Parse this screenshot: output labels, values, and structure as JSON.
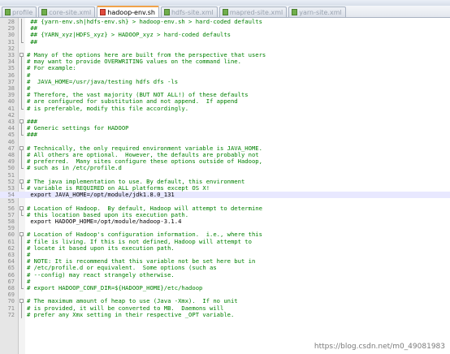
{
  "tabs": [
    {
      "label": "profile",
      "icon": "green",
      "active": false
    },
    {
      "label": "core-site.xml",
      "icon": "green",
      "active": false
    },
    {
      "label": "hadoop-env.sh",
      "icon": "red",
      "active": true
    },
    {
      "label": "hdfs-site.xml",
      "icon": "green",
      "active": false
    },
    {
      "label": "mapred-site.xml",
      "icon": "green",
      "active": false
    },
    {
      "label": "yarn-site.xml",
      "icon": "green",
      "active": false
    }
  ],
  "lines": [
    {
      "n": "28",
      "text": " ## {yarn-env.sh|hdfs-env.sh} > hadoop-env.sh > hard-coded defaults",
      "fold": "bar",
      "kind": "comment"
    },
    {
      "n": "29",
      "text": " ##",
      "fold": "bar",
      "kind": "comment"
    },
    {
      "n": "30",
      "text": " ## {YARN_xyz|HDFS_xyz} > HADOOP_xyz > hard-coded defaults",
      "fold": "bar",
      "kind": "comment"
    },
    {
      "n": "31",
      "text": " ##",
      "fold": "end",
      "kind": "comment"
    },
    {
      "n": "32",
      "text": "",
      "fold": "",
      "kind": "comment"
    },
    {
      "n": "33",
      "text": "# Many of the options here are built from the perspective that users",
      "fold": "box",
      "kind": "comment"
    },
    {
      "n": "34",
      "text": "# may want to provide OVERWRITING values on the command line.",
      "fold": "bar",
      "kind": "comment"
    },
    {
      "n": "35",
      "text": "# For example:",
      "fold": "bar",
      "kind": "comment"
    },
    {
      "n": "36",
      "text": "#",
      "fold": "bar",
      "kind": "comment"
    },
    {
      "n": "37",
      "text": "#  JAVA_HOME=/usr/java/testing hdfs dfs -ls",
      "fold": "bar",
      "kind": "comment"
    },
    {
      "n": "38",
      "text": "#",
      "fold": "bar",
      "kind": "comment"
    },
    {
      "n": "39",
      "text": "# Therefore, the vast majority (BUT NOT ALL!) of these defaults",
      "fold": "bar",
      "kind": "comment"
    },
    {
      "n": "40",
      "text": "# are configured for substitution and not append.  If append",
      "fold": "bar",
      "kind": "comment"
    },
    {
      "n": "41",
      "text": "# is preferable, modify this file accordingly.",
      "fold": "end",
      "kind": "comment"
    },
    {
      "n": "42",
      "text": "",
      "fold": "",
      "kind": "comment"
    },
    {
      "n": "43",
      "text": "###",
      "fold": "box",
      "kind": "comment"
    },
    {
      "n": "44",
      "text": "# Generic settings for HADOOP",
      "fold": "bar",
      "kind": "comment"
    },
    {
      "n": "45",
      "text": "###",
      "fold": "end",
      "kind": "comment"
    },
    {
      "n": "46",
      "text": "",
      "fold": "",
      "kind": "comment"
    },
    {
      "n": "47",
      "text": "# Technically, the only required environment variable is JAVA_HOME.",
      "fold": "box",
      "kind": "comment"
    },
    {
      "n": "48",
      "text": "# All others are optional.  However, the defaults are probably not",
      "fold": "bar",
      "kind": "comment"
    },
    {
      "n": "49",
      "text": "# preferred.  Many sites configure these options outside of Hadoop,",
      "fold": "bar",
      "kind": "comment"
    },
    {
      "n": "50",
      "text": "# such as in /etc/profile.d",
      "fold": "end",
      "kind": "comment"
    },
    {
      "n": "51",
      "text": "",
      "fold": "",
      "kind": "comment"
    },
    {
      "n": "52",
      "text": "# The java implementation to use. By default, this environment",
      "fold": "box",
      "kind": "comment"
    },
    {
      "n": "53",
      "text": "# variable is REQUIRED on ALL platforms except OS X!",
      "fold": "end",
      "kind": "comment"
    },
    {
      "n": "54",
      "text": " export JAVA_HOME=/opt/module/jdk1.8.0_131",
      "fold": "",
      "kind": "plain",
      "highlight": true
    },
    {
      "n": "55",
      "text": "",
      "fold": "",
      "kind": "comment"
    },
    {
      "n": "56",
      "text": "# Location of Hadoop.  By default, Hadoop will attempt to determine",
      "fold": "box",
      "kind": "comment"
    },
    {
      "n": "57",
      "text": "# this location based upon its execution path.",
      "fold": "end",
      "kind": "comment"
    },
    {
      "n": "58",
      "text": " export HADOOP_HOME=/opt/module/hadoop-3.1.4",
      "fold": "",
      "kind": "plain"
    },
    {
      "n": "59",
      "text": "",
      "fold": "",
      "kind": "comment"
    },
    {
      "n": "60",
      "text": "# Location of Hadoop's configuration information.  i.e., where this",
      "fold": "box",
      "kind": "comment"
    },
    {
      "n": "61",
      "text": "# file is living. If this is not defined, Hadoop will attempt to",
      "fold": "bar",
      "kind": "comment"
    },
    {
      "n": "62",
      "text": "# locate it based upon its execution path.",
      "fold": "bar",
      "kind": "comment"
    },
    {
      "n": "63",
      "text": "#",
      "fold": "bar",
      "kind": "comment"
    },
    {
      "n": "64",
      "text": "# NOTE: It is recommend that this variable not be set here but in",
      "fold": "bar",
      "kind": "comment"
    },
    {
      "n": "65",
      "text": "# /etc/profile.d or equivalent.  Some options (such as",
      "fold": "bar",
      "kind": "comment"
    },
    {
      "n": "66",
      "text": "# --config) may react strangely otherwise.",
      "fold": "bar",
      "kind": "comment"
    },
    {
      "n": "67",
      "text": "#",
      "fold": "bar",
      "kind": "comment"
    },
    {
      "n": "68",
      "text": "# export HADOOP_CONF_DIR=${HADOOP_HOME}/etc/hadoop",
      "fold": "end",
      "kind": "comment"
    },
    {
      "n": "69",
      "text": "",
      "fold": "",
      "kind": "comment"
    },
    {
      "n": "70",
      "text": "# The maximum amount of heap to use (Java -Xmx).  If no unit",
      "fold": "box",
      "kind": "comment"
    },
    {
      "n": "71",
      "text": "# is provided, it will be converted to MB.  Daemons will",
      "fold": "bar",
      "kind": "comment"
    },
    {
      "n": "72",
      "text": "# prefer any Xmx setting in their respective _OPT variable.",
      "fold": "bar",
      "kind": "comment"
    }
  ],
  "watermark": "https://blog.csdn.net/m0_49081983",
  "colors": {
    "comment": "#008000",
    "code": "#000000",
    "current_line": "#e8e8ff"
  }
}
